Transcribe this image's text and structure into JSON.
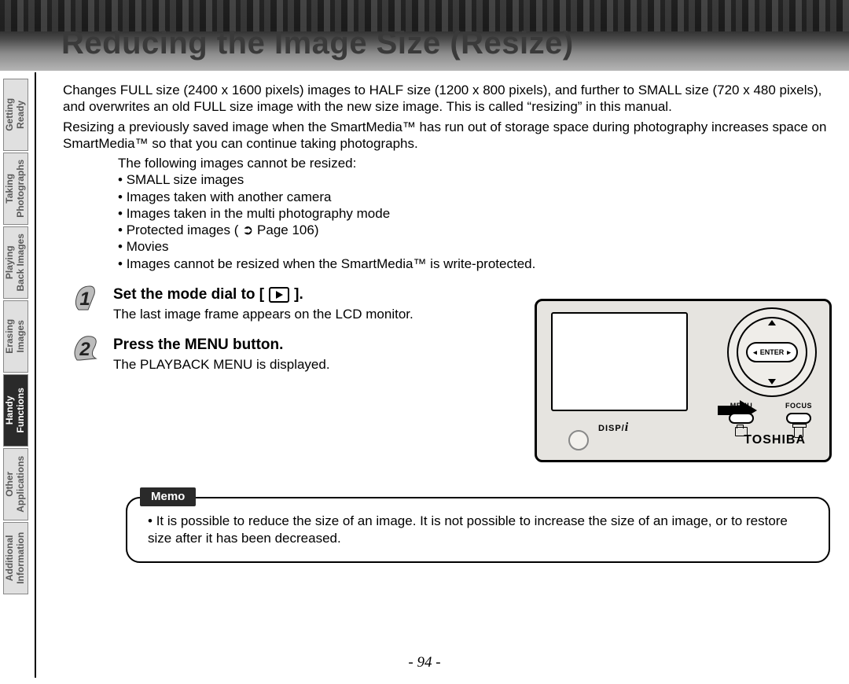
{
  "title": "Reducing the Image Size (Resize)",
  "tabs": [
    {
      "label": "Getting\nReady",
      "active": false
    },
    {
      "label": "Taking\nPhotographs",
      "active": false
    },
    {
      "label": "Playing\nBack Images",
      "active": false
    },
    {
      "label": "Erasing\nImages",
      "active": false
    },
    {
      "label": "Handy\nFunctions",
      "active": true
    },
    {
      "label": "Other\nApplications",
      "active": false
    },
    {
      "label": "Additional\nInformation",
      "active": false
    }
  ],
  "intro_p1": "Changes FULL size (2400 x 1600 pixels) images to HALF size (1200 x 800 pixels), and further to SMALL size (720 x 480 pixels), and overwrites an old FULL size image with the new size image. This is called “resizing” in this manual.",
  "intro_p2": "Resizing a previously saved image when the SmartMedia™ has run out of storage space during photography increases space on SmartMedia™ so that you can continue taking photographs.",
  "cannot_intro": "The following images cannot be resized:",
  "cannot_list": [
    "SMALL size images",
    "Images taken with another camera",
    "Images taken in the multi photography mode",
    "Protected images ( ➲ Page 106)",
    "Movies",
    "Images cannot be resized when the SmartMedia™ is write-protected."
  ],
  "step1_h_pre": "Set the mode dial to [",
  "step1_h_post": "].",
  "step1_p": "The last image frame appears on the LCD monitor.",
  "step2_h": "Press the MENU button.",
  "step2_p": "The PLAYBACK MENU is displayed.",
  "diagram": {
    "disp_label": "DISP/",
    "enter_label": "ENTER",
    "menu_label": "MENU",
    "focus_label": "FOCUS",
    "brand": "TOSHIBA"
  },
  "memo_tag": "Memo",
  "memo_items": [
    "It is possible to reduce the size of an image. It is not possible to increase the size of an image, or to restore size after it has been decreased."
  ],
  "page_number": "- 94 -"
}
